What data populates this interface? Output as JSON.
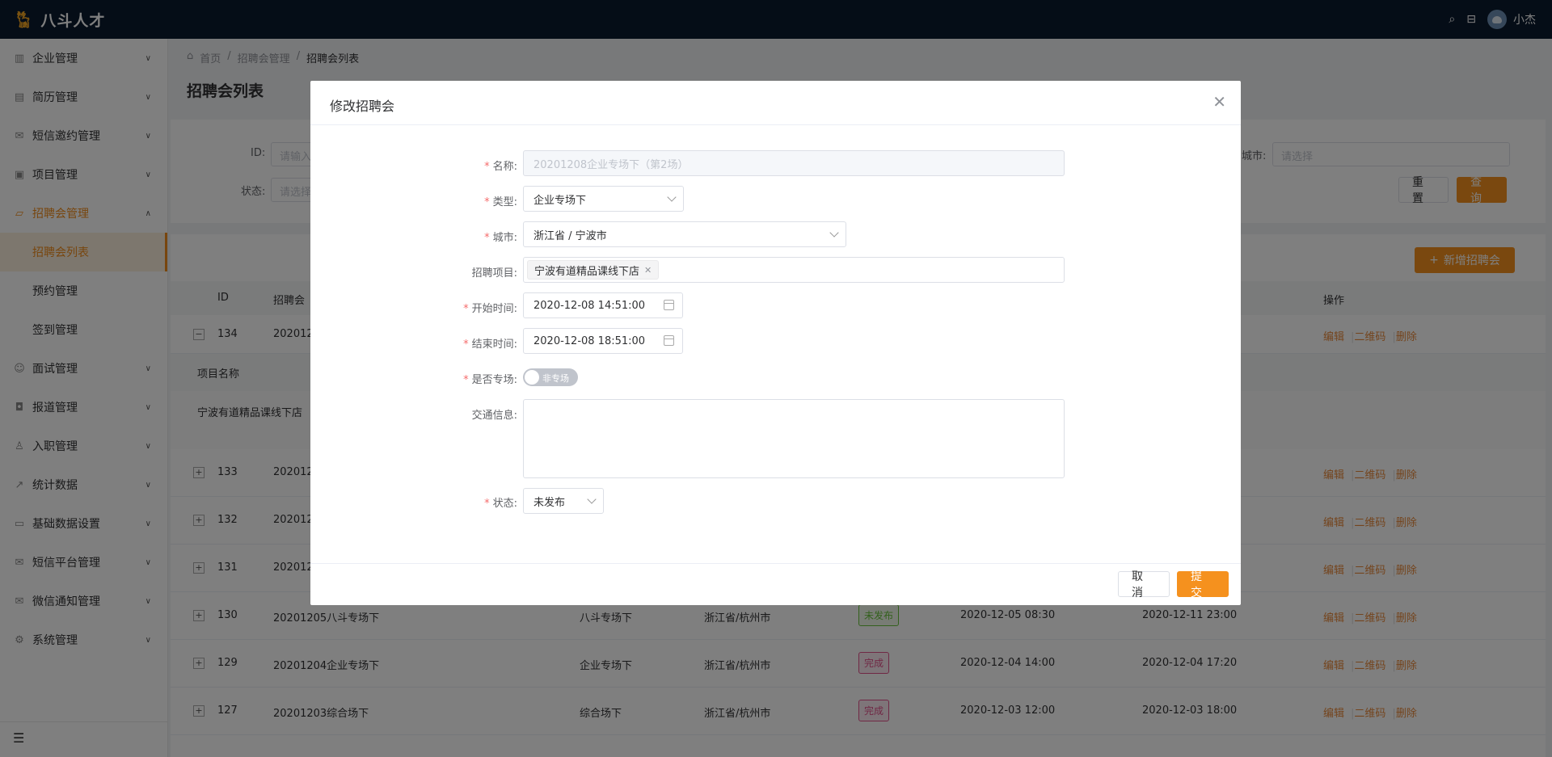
{
  "app": {
    "name": "八斗人才",
    "user": "小杰"
  },
  "sidebar": {
    "items": [
      {
        "label": "企业管理",
        "icon": "building-icon"
      },
      {
        "label": "简历管理",
        "icon": "document-icon"
      },
      {
        "label": "短信邀约管理",
        "icon": "mail-icon"
      },
      {
        "label": "项目管理",
        "icon": "box-icon"
      },
      {
        "label": "招聘会管理",
        "icon": "bag-icon"
      },
      {
        "label": "面试管理",
        "icon": "person-icon"
      },
      {
        "label": "报道管理",
        "icon": "camera-icon"
      },
      {
        "label": "入职管理",
        "icon": "user-icon"
      },
      {
        "label": "统计数据",
        "icon": "chart-icon"
      },
      {
        "label": "基础数据设置",
        "icon": "folder-icon"
      },
      {
        "label": "短信平台管理",
        "icon": "mail-icon"
      },
      {
        "label": "微信通知管理",
        "icon": "mail-icon"
      },
      {
        "label": "系统管理",
        "icon": "gear-icon"
      }
    ],
    "sub_items": [
      "招聘会列表",
      "预约管理",
      "签到管理"
    ]
  },
  "breadcrumb": [
    "首页",
    "招聘会管理",
    "招聘会列表"
  ],
  "page_title": "招聘会列表",
  "filters": {
    "id_label": "ID:",
    "id_placeholder": "请输入",
    "status_label": "状态:",
    "status_placeholder": "请选择",
    "city_label": "城市:",
    "city_placeholder": "请选择",
    "reset": "重 置",
    "search": "查 询"
  },
  "add_button": "新增招聘会",
  "table": {
    "headers": {
      "id": "ID",
      "name": "招聘会",
      "ops": "操作"
    },
    "expanded_header": "项目名称",
    "expanded_value": "宁波有道精品课线下店",
    "ops": {
      "edit": "编辑",
      "qr": "二维码",
      "delete": "删除"
    },
    "rows": [
      {
        "id": "134",
        "name": "202012",
        "type": "",
        "city": "",
        "status": "",
        "start": "",
        "end": ""
      },
      {
        "id": "133",
        "name": "202012",
        "type": "",
        "city": "",
        "status": "",
        "start": "",
        "end": ""
      },
      {
        "id": "132",
        "name": "202012",
        "type": "",
        "city": "",
        "status": "",
        "start": "",
        "end": ""
      },
      {
        "id": "131",
        "name": "202012",
        "type": "",
        "city": "",
        "status": "",
        "start": "",
        "end": ""
      },
      {
        "id": "130",
        "name": "20201205八斗专场下",
        "type": "八斗专场下",
        "city": "浙江省/杭州市",
        "status": "未发布",
        "start": "2020-12-05 08:30",
        "end": "2020-12-11 23:00"
      },
      {
        "id": "129",
        "name": "20201204企业专场下",
        "type": "企业专场下",
        "city": "浙江省/杭州市",
        "status": "完成",
        "start": "2020-12-04 14:00",
        "end": "2020-12-04 17:20"
      },
      {
        "id": "127",
        "name": "20201203综合场下",
        "type": "综合场下",
        "city": "浙江省/杭州市",
        "status": "完成",
        "start": "2020-12-03 12:00",
        "end": "2020-12-03 18:00"
      }
    ]
  },
  "dialog": {
    "title": "修改招聘会",
    "name_label": "名称:",
    "name_value": "20201208企业专场下（第2场）",
    "type_label": "类型:",
    "type_value": "企业专场下",
    "city_label": "城市:",
    "city_value": "浙江省 / 宁波市",
    "project_label": "招聘项目:",
    "project_chip": "宁波有道精品课线下店",
    "start_label": "开始时间:",
    "start_value": "2020-12-08 14:51:00",
    "end_label": "结束时间:",
    "end_value": "2020-12-08 18:51:00",
    "special_label": "是否专场:",
    "special_toggle": "非专场",
    "traffic_label": "交通信息:",
    "status_label": "状态:",
    "status_value": "未发布",
    "cancel": "取 消",
    "submit": "提 交"
  }
}
